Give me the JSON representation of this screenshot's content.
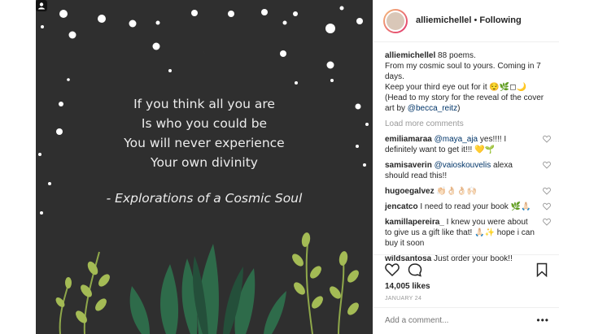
{
  "post": {
    "quote_lines": [
      "If you think all you are",
      "Is who you could be",
      "You will never experience",
      "Your own divinity"
    ],
    "quote_source": "- Explorations of a Cosmic Soul"
  },
  "header": {
    "username": "alliemichellel",
    "separator": "•",
    "follow_status": "Following"
  },
  "caption": {
    "username": "alliemichellel",
    "line1": "88 poems.",
    "line2": "From my cosmic soul to yours. Coming in 7 days.",
    "line3": "Keep your third eye out for it 😌🌿◻🌙",
    "line4_prefix": "(Head to my story for the reveal of the cover art by ",
    "line4_mention": "@becca_reitz",
    "line4_suffix": ")"
  },
  "load_more": "Load more comments",
  "comments": [
    {
      "user": "emiliamaraa",
      "mention": "@maya_aja",
      "text": " yes!!!! I definitely want to get it!!! 💛🌱"
    },
    {
      "user": "samisaverin",
      "mention": "@vaioskouvelis",
      "text": " alexa should read this!!"
    },
    {
      "user": "hugoegalvez",
      "mention": "",
      "text": " 👏🏻👌🏻👌🏻🙌🏻"
    },
    {
      "user": "jencatco",
      "mention": "",
      "text": " I need to read your book 🌿🙏🏻"
    },
    {
      "user": "kamillapereira_",
      "mention": "",
      "text": " I knew you were about to give us a gift like that! 🙏🏻✨ hope i can buy it soon"
    },
    {
      "user": "wildsantosa",
      "mention": "",
      "text": " Just order your book!!"
    }
  ],
  "likes": "14,005 likes",
  "date": "JANUARY 24",
  "add_comment_placeholder": "Add a comment...",
  "more_options": "•••",
  "colors": {
    "image_bg": "#2f2f2f",
    "mention": "#003569",
    "muted": "#999999"
  }
}
